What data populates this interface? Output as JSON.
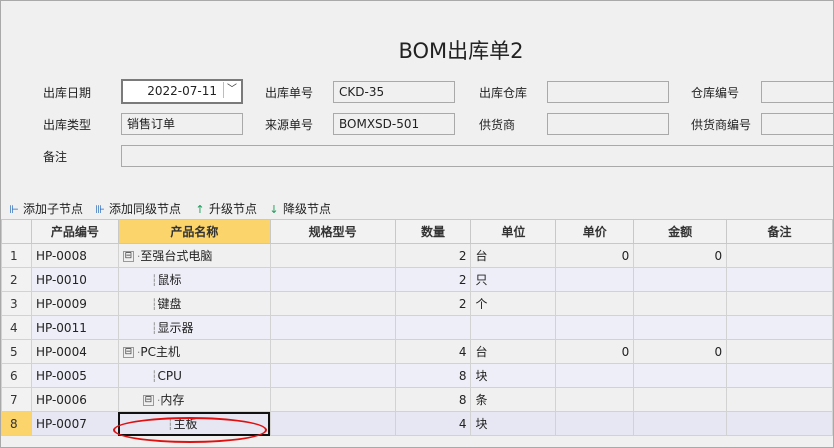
{
  "form": {
    "title": "BOM出库单2",
    "fields": {
      "out_date_label": "出库日期",
      "out_date_value": "2022-07-11",
      "out_no_label": "出库单号",
      "out_no_value": "CKD-35",
      "warehouse_label": "出库仓库",
      "warehouse_value": "",
      "warehouse_no_label": "仓库编号",
      "warehouse_no_value": "",
      "out_type_label": "出库类型",
      "out_type_value": "销售订单",
      "source_no_label": "来源单号",
      "source_no_value": "BOMXSD-501",
      "supplier_label": "供货商",
      "supplier_value": "",
      "supplier_no_label": "供货商编号",
      "supplier_no_value": "",
      "remark_label": "备注",
      "remark_value": ""
    }
  },
  "toolbar": {
    "add_child": "添加子节点",
    "add_sibling": "添加同级节点",
    "upgrade": "升级节点",
    "downgrade": "降级节点"
  },
  "grid": {
    "columns": [
      "",
      "产品编号",
      "产品名称",
      "规格型号",
      "数量",
      "单位",
      "单价",
      "金额",
      "备注"
    ],
    "rows": [
      {
        "n": "1",
        "code": "HP-0008",
        "name": "至强台式电脑",
        "spec": "",
        "qty": "2",
        "unit": "台",
        "price": "0",
        "amount": "0",
        "remark": ""
      },
      {
        "n": "2",
        "code": "HP-0010",
        "name": "鼠标",
        "spec": "",
        "qty": "2",
        "unit": "只",
        "price": "",
        "amount": "",
        "remark": ""
      },
      {
        "n": "3",
        "code": "HP-0009",
        "name": "键盘",
        "spec": "",
        "qty": "2",
        "unit": "个",
        "price": "",
        "amount": "",
        "remark": ""
      },
      {
        "n": "4",
        "code": "HP-0011",
        "name": "显示器",
        "spec": "",
        "qty": "",
        "unit": "",
        "price": "",
        "amount": "",
        "remark": ""
      },
      {
        "n": "5",
        "code": "HP-0004",
        "name": "PC主机",
        "spec": "",
        "qty": "4",
        "unit": "台",
        "price": "0",
        "amount": "0",
        "remark": ""
      },
      {
        "n": "6",
        "code": "HP-0005",
        "name": "CPU",
        "spec": "",
        "qty": "8",
        "unit": "块",
        "price": "",
        "amount": "",
        "remark": ""
      },
      {
        "n": "7",
        "code": "HP-0006",
        "name": "内存",
        "spec": "",
        "qty": "8",
        "unit": "条",
        "price": "",
        "amount": "",
        "remark": ""
      },
      {
        "n": "8",
        "code": "HP-0007",
        "name": "主板",
        "spec": "",
        "qty": "4",
        "unit": "块",
        "price": "",
        "amount": "",
        "remark": ""
      }
    ]
  },
  "icons": {
    "tree_expanded": "⊟",
    "dropdown": "﹀"
  },
  "colors": {
    "accent": "#fbd46b",
    "highlight_oval": "#e01010"
  }
}
